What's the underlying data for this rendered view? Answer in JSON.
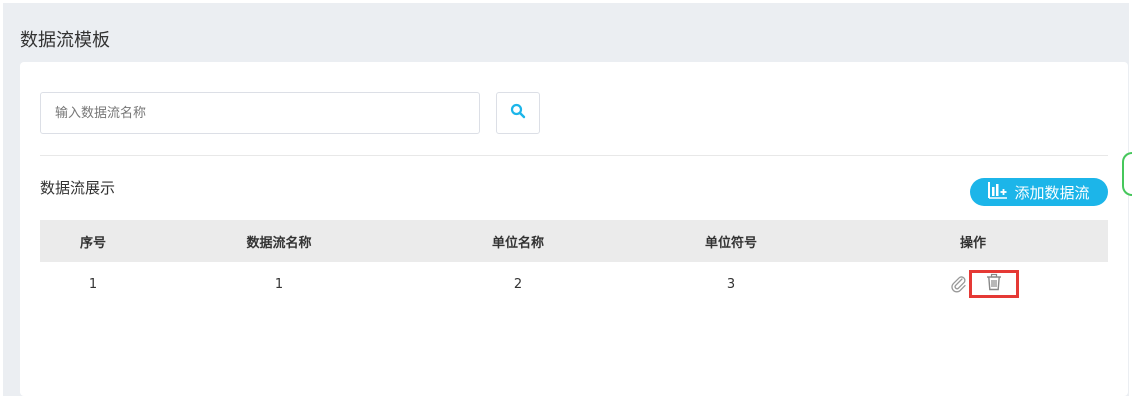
{
  "page": {
    "title": "数据流模板"
  },
  "search": {
    "placeholder": "输入数据流名称",
    "value": ""
  },
  "section": {
    "title": "数据流展示",
    "add_button_label": "添加数据流"
  },
  "table": {
    "headers": {
      "index": "序号",
      "name": "数据流名称",
      "unit_name": "单位名称",
      "unit_symbol": "单位符号",
      "actions": "操作"
    },
    "rows": [
      {
        "index": "1",
        "name": "1",
        "unit_name": "2",
        "unit_symbol": "3"
      }
    ]
  },
  "icons": {
    "search": "search-icon",
    "add": "add-chart-icon",
    "edit": "paperclip-edit-icon",
    "delete": "trash-icon"
  },
  "colors": {
    "accent": "#1cb5e9",
    "highlight": "#e53935",
    "header_bg": "#ebebeb",
    "page_bg": "#ebeef2"
  }
}
